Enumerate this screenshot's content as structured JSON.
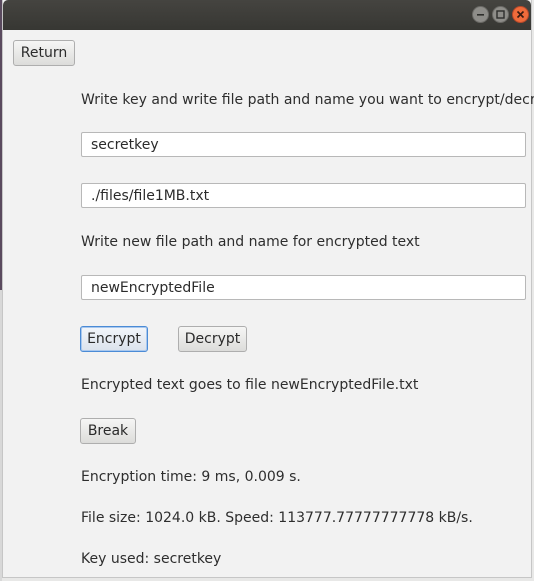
{
  "window": {
    "controls": {
      "minimize_icon": "minimize-icon",
      "maximize_icon": "maximize-icon",
      "close_icon": "close-icon"
    }
  },
  "toolbar": {
    "return_label": "Return"
  },
  "form": {
    "instruction": "Write key and write file path and name you want to encrypt/decrypt",
    "key_value": "secretkey",
    "input_path_value": "./files/file1MB.txt",
    "output_instruction": "Write new file path and name for encrypted text",
    "output_path_value": "newEncryptedFile"
  },
  "actions": {
    "encrypt_label": "Encrypt",
    "decrypt_label": "Decrypt",
    "break_label": "Break"
  },
  "results": {
    "output_message": "Encrypted text goes to file newEncryptedFile.txt",
    "encryption_time": "Encryption time: 9 ms, 0.009 s.",
    "file_size_speed": "File size: 1024.0 kB. Speed: 113777.77777777778 kB/s.",
    "key_used": "Key used: secretkey"
  },
  "colors": {
    "titlebar": "#3d3c38",
    "close_button": "#ef6b3b",
    "focus_border": "#4b8bd6",
    "window_background": "#f2f2f2"
  }
}
